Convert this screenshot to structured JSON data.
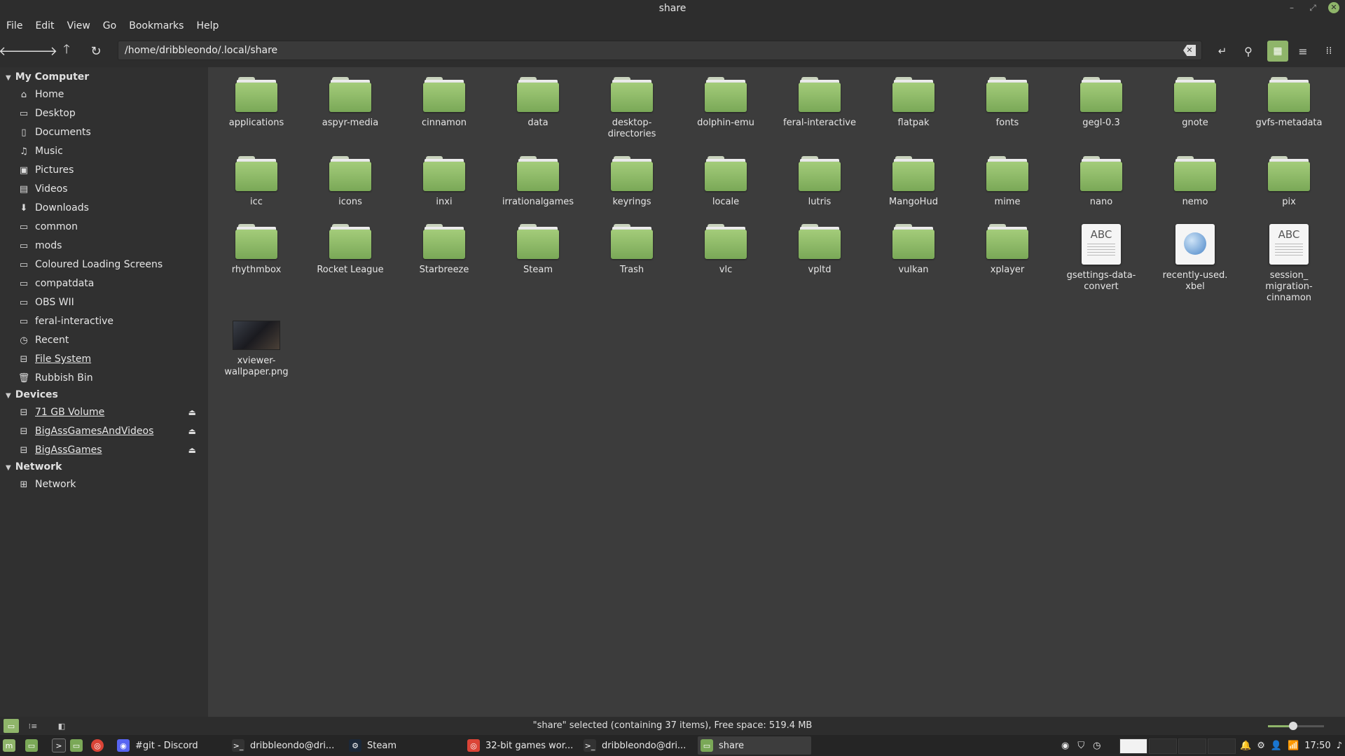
{
  "window": {
    "title": "share"
  },
  "menu": [
    "File",
    "Edit",
    "View",
    "Go",
    "Bookmarks",
    "Help"
  ],
  "toolbar": {
    "path": "/home/dribbleondo/.local/share"
  },
  "sidebar": {
    "sections": [
      {
        "title": "My Computer",
        "items": [
          {
            "label": "Home",
            "icon": "home-icon",
            "glyph": "⌂"
          },
          {
            "label": "Desktop",
            "icon": "desktop-icon",
            "glyph": "▭"
          },
          {
            "label": "Documents",
            "icon": "documents-icon",
            "glyph": "▯"
          },
          {
            "label": "Music",
            "icon": "music-icon",
            "glyph": "♫"
          },
          {
            "label": "Pictures",
            "icon": "pictures-icon",
            "glyph": "▣"
          },
          {
            "label": "Videos",
            "icon": "videos-icon",
            "glyph": "▤"
          },
          {
            "label": "Downloads",
            "icon": "downloads-icon",
            "glyph": "⬇"
          },
          {
            "label": "common",
            "icon": "folder-icon",
            "glyph": "▭"
          },
          {
            "label": "mods",
            "icon": "folder-icon",
            "glyph": "▭"
          },
          {
            "label": "Coloured Loading Screens",
            "icon": "folder-icon",
            "glyph": "▭"
          },
          {
            "label": "compatdata",
            "icon": "folder-icon",
            "glyph": "▭"
          },
          {
            "label": "OBS WII",
            "icon": "folder-icon",
            "glyph": "▭"
          },
          {
            "label": "feral-interactive",
            "icon": "folder-icon",
            "glyph": "▭"
          },
          {
            "label": "Recent",
            "icon": "recent-icon",
            "glyph": "◷"
          },
          {
            "label": "File System",
            "icon": "filesystem-icon",
            "glyph": "⊟",
            "underline": true
          },
          {
            "label": "Rubbish Bin",
            "icon": "trash-icon",
            "glyph": "🗑"
          }
        ]
      },
      {
        "title": "Devices",
        "items": [
          {
            "label": "71 GB Volume",
            "icon": "drive-icon",
            "glyph": "⊟",
            "underline": true,
            "eject": true
          },
          {
            "label": "BigAssGamesAndVideos",
            "icon": "drive-icon",
            "glyph": "⊟",
            "underline": true,
            "eject": true
          },
          {
            "label": "BigAssGames",
            "icon": "drive-icon",
            "glyph": "⊟",
            "underline": true,
            "eject": true
          }
        ]
      },
      {
        "title": "Network",
        "items": [
          {
            "label": "Network",
            "icon": "network-icon",
            "glyph": "⊞"
          }
        ]
      }
    ]
  },
  "files": [
    {
      "name": "applications",
      "type": "folder"
    },
    {
      "name": "aspyr-media",
      "type": "folder"
    },
    {
      "name": "cinnamon",
      "type": "folder"
    },
    {
      "name": "data",
      "type": "folder"
    },
    {
      "name": "desktop-\ndirectories",
      "type": "folder"
    },
    {
      "name": "dolphin-emu",
      "type": "folder"
    },
    {
      "name": "feral-interactive",
      "type": "folder"
    },
    {
      "name": "flatpak",
      "type": "folder"
    },
    {
      "name": "fonts",
      "type": "folder"
    },
    {
      "name": "gegl-0.3",
      "type": "folder"
    },
    {
      "name": "gnote",
      "type": "folder"
    },
    {
      "name": "gvfs-metadata",
      "type": "folder"
    },
    {
      "name": "icc",
      "type": "folder"
    },
    {
      "name": "icons",
      "type": "folder"
    },
    {
      "name": "inxi",
      "type": "folder"
    },
    {
      "name": "irrationalgames",
      "type": "folder"
    },
    {
      "name": "keyrings",
      "type": "folder"
    },
    {
      "name": "locale",
      "type": "folder"
    },
    {
      "name": "lutris",
      "type": "folder"
    },
    {
      "name": "MangoHud",
      "type": "folder"
    },
    {
      "name": "mime",
      "type": "folder"
    },
    {
      "name": "nano",
      "type": "folder"
    },
    {
      "name": "nemo",
      "type": "folder"
    },
    {
      "name": "pix",
      "type": "folder"
    },
    {
      "name": "rhythmbox",
      "type": "folder"
    },
    {
      "name": "Rocket League",
      "type": "folder"
    },
    {
      "name": "Starbreeze",
      "type": "folder"
    },
    {
      "name": "Steam",
      "type": "folder"
    },
    {
      "name": "Trash",
      "type": "folder"
    },
    {
      "name": "vlc",
      "type": "folder"
    },
    {
      "name": "vpltd",
      "type": "folder"
    },
    {
      "name": "vulkan",
      "type": "folder"
    },
    {
      "name": "xplayer",
      "type": "folder"
    },
    {
      "name": "gsettings-data-\nconvert",
      "type": "text",
      "badge": "ABC"
    },
    {
      "name": "recently-used.\nxbel",
      "type": "xbel"
    },
    {
      "name": "session_\nmigration-\ncinnamon",
      "type": "text",
      "badge": "ABC"
    },
    {
      "name": "xviewer-\nwallpaper.png",
      "type": "image"
    }
  ],
  "status": {
    "text": "\"share\" selected (containing 37 items), Free space: 519.4 MB",
    "zoom": 0.45
  },
  "taskbar": {
    "tasks": [
      {
        "label": "#git - Discord",
        "icon": "discord-icon",
        "color": "#5865f2",
        "glyph": "◉"
      },
      {
        "label": "dribbleondo@dri...",
        "icon": "terminal-icon",
        "color": "#333",
        "glyph": ">_"
      },
      {
        "label": "Steam",
        "icon": "steam-icon",
        "color": "#1b2838",
        "glyph": "⚙"
      },
      {
        "label": "32-bit games wor...",
        "icon": "chrome-icon",
        "color": "#db4437",
        "glyph": "◎"
      },
      {
        "label": "dribbleondo@dri...",
        "icon": "terminal-icon",
        "color": "#333",
        "glyph": ">_"
      },
      {
        "label": "share",
        "icon": "folder-icon",
        "color": "#7aa857",
        "glyph": "▭",
        "active": true
      }
    ],
    "clock": "17:50"
  },
  "colors": {
    "accent": "#8fb56a",
    "folder": "#7aa857"
  }
}
